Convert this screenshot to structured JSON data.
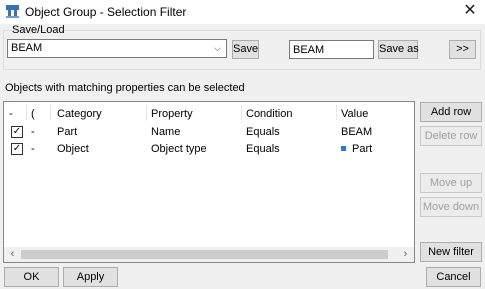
{
  "window": {
    "title": "Object Group - Selection Filter"
  },
  "save_load": {
    "group_label": "Save/Load",
    "selected": "BEAM",
    "save_label": "Save",
    "name_value": "BEAM",
    "save_as_label": "Save as",
    "more_label": ">>"
  },
  "description": "Objects with matching properties can be selected",
  "grid": {
    "columns": [
      "-",
      "(",
      "Category",
      "Property",
      "Condition",
      "Value"
    ],
    "rows": [
      {
        "checked": true,
        "dash": "-",
        "category": "Part",
        "property": "Name",
        "condition": "Equals",
        "value": "BEAM",
        "value_icon": ""
      },
      {
        "checked": true,
        "dash": "-",
        "category": "Object",
        "property": "Object type",
        "condition": "Equals",
        "value": "Part",
        "value_icon": "blue-square-icon"
      }
    ]
  },
  "side_buttons": {
    "add_row": "Add row",
    "delete_row": "Delete row",
    "move_up": "Move up",
    "move_down": "Move down",
    "new_filter": "New filter"
  },
  "footer": {
    "ok": "OK",
    "apply": "Apply",
    "cancel": "Cancel"
  },
  "colors": {
    "accent_icon": "#2b7bd6",
    "grid_border": "#828790",
    "button_bg": "#e1e1e1"
  }
}
